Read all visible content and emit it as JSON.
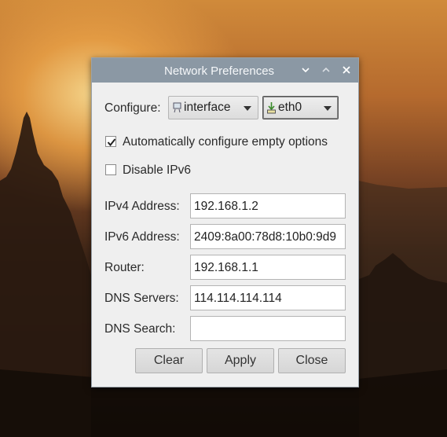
{
  "window": {
    "title": "Network Preferences",
    "minimize_glyph": "⌄",
    "maximize_glyph": "⌃",
    "close_glyph": "✕"
  },
  "configure": {
    "label": "Configure:",
    "type_value": "interface",
    "interface_value": "eth0"
  },
  "options": {
    "auto_configure": {
      "label": "Automatically configure empty options",
      "checked": true
    },
    "disable_ipv6": {
      "label": "Disable IPv6",
      "checked": false
    }
  },
  "fields": {
    "ipv4": {
      "label": "IPv4 Address:",
      "value": "192.168.1.2"
    },
    "ipv6": {
      "label": "IPv6 Address:",
      "value": "2409:8a00:78d8:10b0:9d9"
    },
    "router": {
      "label": "Router:",
      "value": "192.168.1.1"
    },
    "dns_servers": {
      "label": "DNS Servers:",
      "value": "114.114.114.114"
    },
    "dns_search": {
      "label": "DNS Search:",
      "value": ""
    }
  },
  "buttons": {
    "clear": "Clear",
    "apply": "Apply",
    "close": "Close"
  },
  "colors": {
    "titlebar": "#8b98a4",
    "window_bg": "#efefef"
  }
}
